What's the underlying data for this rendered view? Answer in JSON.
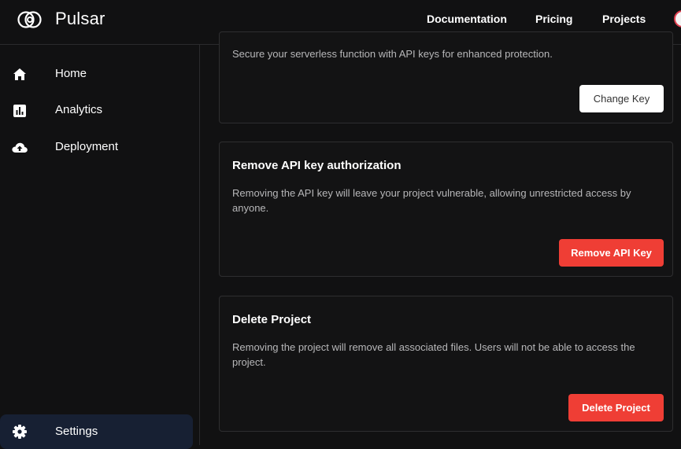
{
  "header": {
    "brand": "Pulsar",
    "nav": [
      "Documentation",
      "Pricing",
      "Projects"
    ]
  },
  "sidebar": {
    "items": [
      {
        "label": "Home",
        "icon": "home-icon"
      },
      {
        "label": "Analytics",
        "icon": "analytics-icon"
      },
      {
        "label": "Deployment",
        "icon": "cloud-upload-icon"
      },
      {
        "label": "Settings",
        "icon": "gear-icon",
        "active": true
      }
    ]
  },
  "cards": {
    "api_key": {
      "description": "Secure your serverless function with API keys for enhanced protection.",
      "button": "Change Key"
    },
    "remove_auth": {
      "title": "Remove API key authorization",
      "description": "Removing the API key will leave your project vulnerable, allowing unrestricted access by anyone.",
      "button": "Remove API Key"
    },
    "delete_project": {
      "title": "Delete Project",
      "description": "Removing the project will remove all associated files. Users will not be able to access the project.",
      "button": "Delete Project"
    }
  },
  "colors": {
    "background": "#111112",
    "danger": "#ef3e35",
    "active_sidebar": "#172033"
  }
}
